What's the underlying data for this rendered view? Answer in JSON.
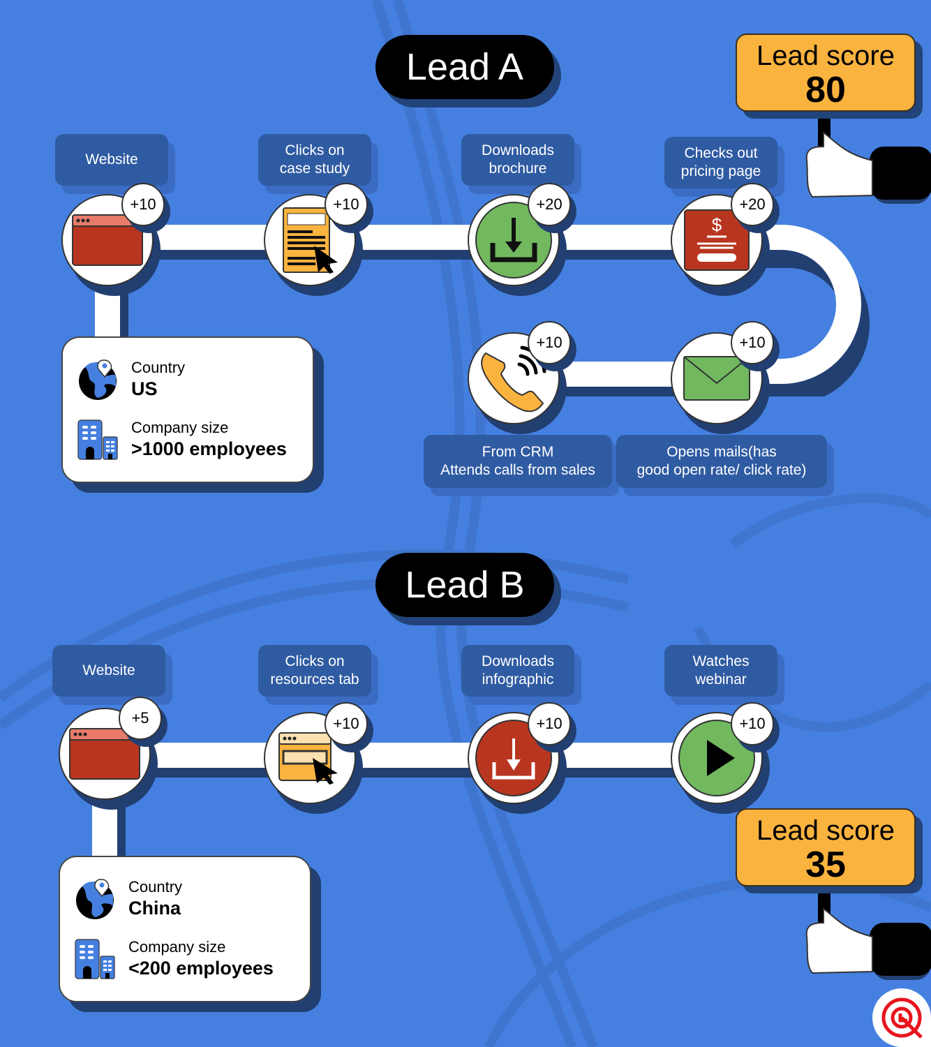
{
  "colors": {
    "background": "#4580e0",
    "label_box": "#2f5ba2",
    "score_sign": "#fbb33f",
    "red": "#b8361f",
    "green": "#72b85f",
    "orange": "#fbb33f",
    "brand_red": "#e8141c"
  },
  "leads": [
    {
      "title": "Lead A",
      "score_label": "Lead score",
      "score": "80",
      "steps": [
        {
          "label": "Website",
          "points": "+10",
          "icon": "browser-window-icon"
        },
        {
          "label": "Clicks on\ncase study",
          "points": "+10",
          "icon": "case-study-document-icon"
        },
        {
          "label": "Downloads\nbrochure",
          "points": "+20",
          "icon": "download-icon"
        },
        {
          "label": "Checks out\npricing page",
          "points": "+20",
          "icon": "pricing-page-icon"
        },
        {
          "label": "Opens mails(has\ngood open rate/ click rate)",
          "points": "+10",
          "icon": "envelope-icon"
        },
        {
          "label": "From CRM\nAttends calls from sales",
          "points": "+10",
          "icon": "phone-call-icon"
        }
      ],
      "profile": {
        "country_label": "Country",
        "country": "US",
        "size_label": "Company size",
        "size": ">1000 employees"
      }
    },
    {
      "title": "Lead B",
      "score_label": "Lead score",
      "score": "35",
      "steps": [
        {
          "label": "Website",
          "points": "+5",
          "icon": "browser-window-icon"
        },
        {
          "label": "Clicks on\nresources tab",
          "points": "+10",
          "icon": "resources-tab-icon"
        },
        {
          "label": "Downloads\ninfographic",
          "points": "+10",
          "icon": "download-icon"
        },
        {
          "label": "Watches\nwebinar",
          "points": "+10",
          "icon": "play-icon"
        }
      ],
      "profile": {
        "country_label": "Country",
        "country": "China",
        "size_label": "Company size",
        "size": "<200 employees"
      }
    }
  ],
  "brand": {
    "icon": "brand-logo-icon"
  }
}
